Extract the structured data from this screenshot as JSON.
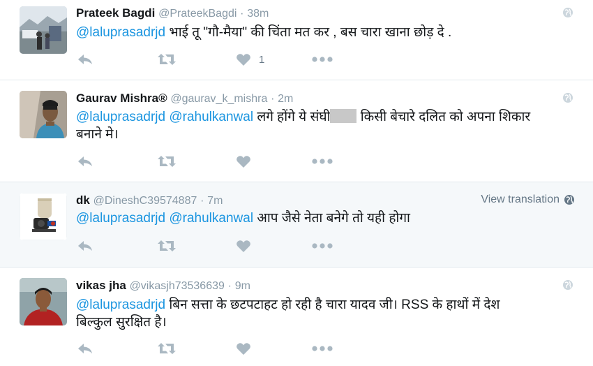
{
  "tweets": [
    {
      "name": "Prateek Bagdi",
      "handle": "@PrateekBagdi",
      "sep": "·",
      "time": "38m",
      "mentions": [
        "@laluprasadrjd"
      ],
      "text_line1": "भाई तू \"गौ-मैया\" की चिंता मत कर , बस चारा खाना छोड़ दे .",
      "like_count": "1"
    },
    {
      "name": "Gaurav Mishra®",
      "handle": "@gaurav_k_mishra",
      "sep": "·",
      "time": "2m",
      "mentions": [
        "@laluprasadrjd",
        "@rahulkanwal"
      ],
      "text_line1_a": "लगे होंगे ये संघी",
      "text_line1_b": "किसी बेचारे दलित को अपना शिकार",
      "text_line2": "बनाने मे।"
    },
    {
      "name": "dk",
      "handle": "@DineshC39574887",
      "sep": "·",
      "time": "7m",
      "view_translation": "View translation",
      "mentions": [
        "@laluprasadrjd",
        "@rahulkanwal"
      ],
      "text_line1": "आप जैसे नेता बनेगे तो यही होगा"
    },
    {
      "name": "vikas jha",
      "handle": "@vikasjh73536639",
      "sep": "·",
      "time": "9m",
      "mentions": [
        "@laluprasadrjd"
      ],
      "text_line1": "बिन सत्ता के छटपटाहट हो रही है चारा यादव जी। RSS के हाथों में देश",
      "text_line2": "बिल्कुल सुरक्षित है।"
    }
  ],
  "icons": {
    "reply": "reply-icon",
    "retweet": "retweet-icon",
    "like": "heart-icon",
    "more": "more-icon",
    "globe": "globe-icon"
  },
  "colors": {
    "mention": "#1b95e0",
    "meta": "#8899a6",
    "action": "#aab8c2",
    "highlight_bg": "#f5f8fa"
  }
}
